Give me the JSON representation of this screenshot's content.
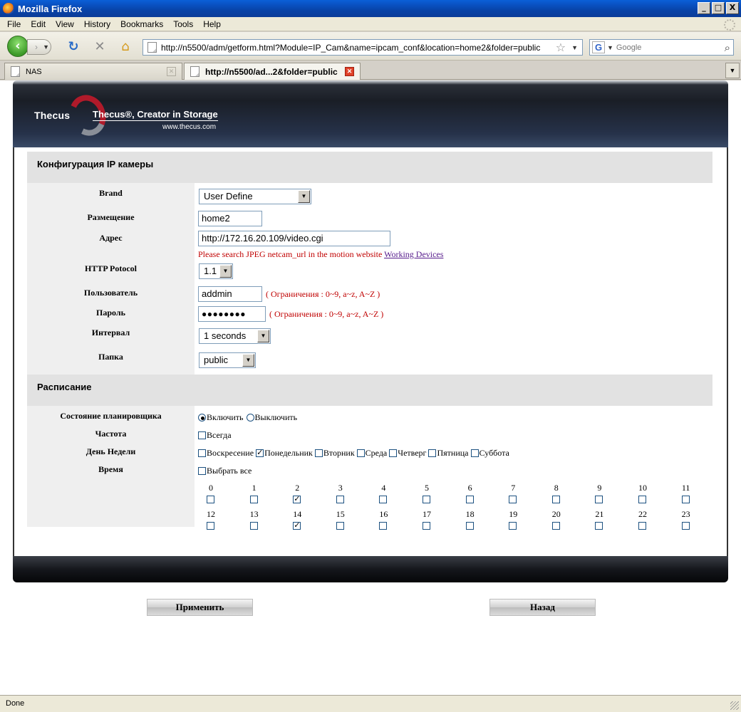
{
  "window": {
    "title": "Mozilla Firefox",
    "min": "_",
    "max": "□",
    "close": "X"
  },
  "menu": [
    "File",
    "Edit",
    "View",
    "History",
    "Bookmarks",
    "Tools",
    "Help"
  ],
  "nav": {
    "url": "http://n5500/adm/getform.html?Module=IP_Cam&name=ipcam_conf&location=home2&folder=public",
    "search_placeholder": "Google"
  },
  "tabs": [
    {
      "label": "NAS"
    },
    {
      "label": "http://n5500/ad...2&folder=public"
    }
  ],
  "banner": {
    "logo": "Thecus",
    "tagline": "Thecus®, Creator in Storage",
    "site": "www.thecus.com"
  },
  "config": {
    "heading": "Конфигурация IP камеры",
    "brand_label": "Brand",
    "brand_value": "User Define",
    "location_label": "Размещение",
    "location_value": "home2",
    "address_label": "Адрес",
    "address_value": "http://172.16.20.109/video.cgi",
    "address_hint": "Please search JPEG netcam_url in the motion website",
    "address_link": "Working Devices",
    "http_label": "HTTP Potocol",
    "http_value": "1.1",
    "user_label": "Пользователь",
    "user_value": "addmin",
    "user_hint": "( Ограничения : 0~9, a~z, A~Z )",
    "pass_label": "Пароль",
    "pass_value": "●●●●●●●●",
    "pass_hint": "( Ограничения : 0~9, a~z, A~Z )",
    "interval_label": "Интервал",
    "interval_value": "1 seconds",
    "folder_label": "Папка",
    "folder_value": "public"
  },
  "schedule": {
    "heading": "Расписание",
    "state_label": "Состояние планировщика",
    "enable": "Включить",
    "disable": "Выключить",
    "enabled": true,
    "freq_label": "Частота",
    "always": "Всегда",
    "always_checked": false,
    "days_label": "День Недели",
    "days": [
      {
        "name": "Воскресение",
        "checked": false
      },
      {
        "name": "Понедельник",
        "checked": true
      },
      {
        "name": "Вторник",
        "checked": false
      },
      {
        "name": "Среда",
        "checked": false
      },
      {
        "name": "Четверг",
        "checked": false
      },
      {
        "name": "Пятница",
        "checked": false
      },
      {
        "name": "Суббота",
        "checked": false
      }
    ],
    "time_label": "Время",
    "select_all": "Выбрать все",
    "checked_hours": [
      2,
      14
    ]
  },
  "buttons": {
    "apply": "Применить",
    "back": "Назад"
  },
  "status": "Done"
}
